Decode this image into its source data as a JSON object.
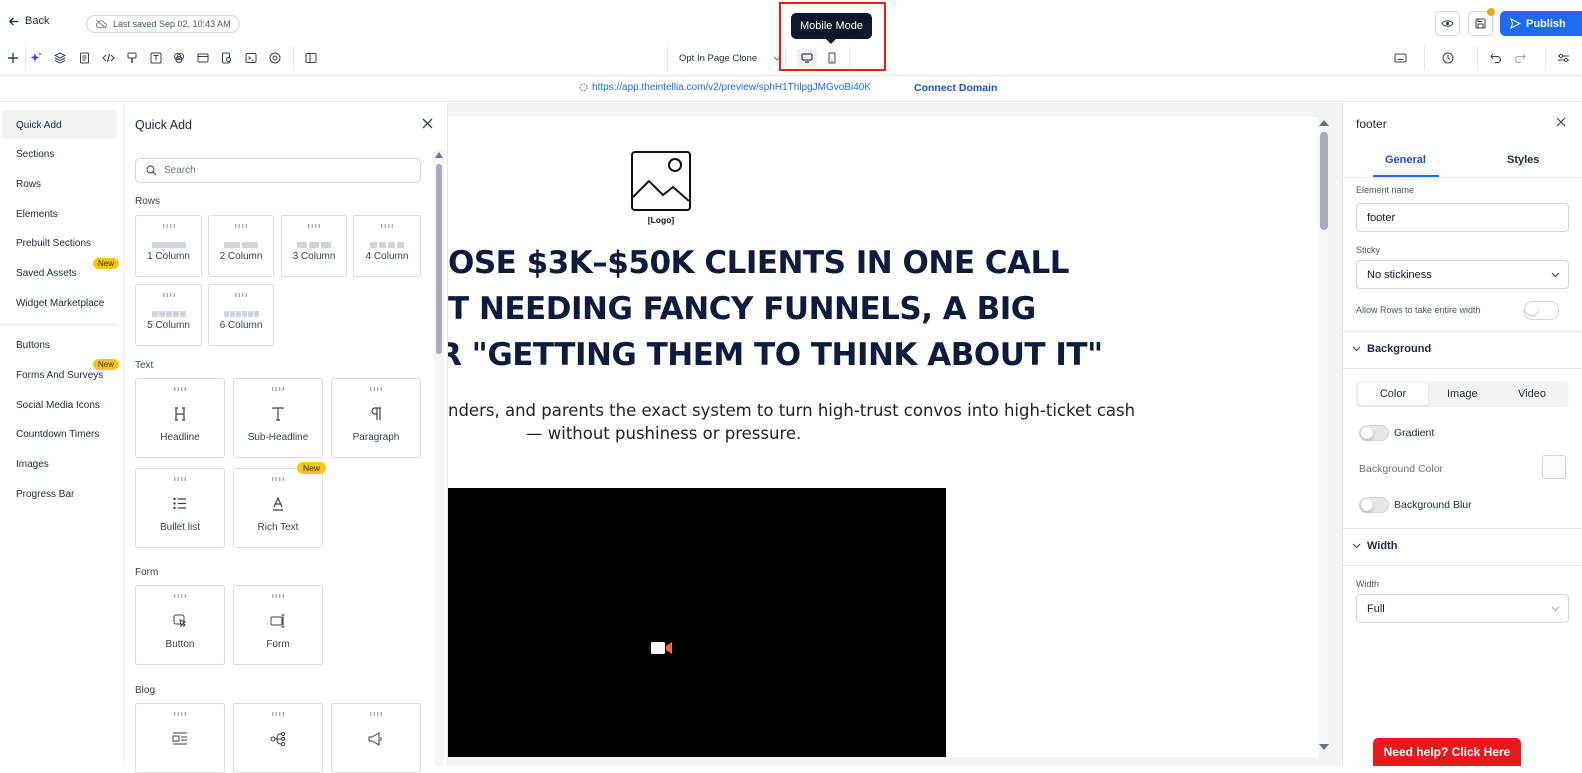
{
  "topbar": {
    "back_label": "Back",
    "last_saved": "Last saved Sep 02, 10:43 AM",
    "page_name": "Opt In Page Clone",
    "tooltip": "Mobile Mode",
    "publish_label": "Publish"
  },
  "urlbar": {
    "url": "https://app.theintellia.com/v2/preview/sphH1ThlpgJMGvoBi40K",
    "connect_label": "Connect Domain"
  },
  "leftnav": {
    "items": [
      "Quick Add",
      "Sections",
      "Rows",
      "Elements",
      "Prebuilt Sections",
      "Saved Assets",
      "Widget Marketplace",
      "Buttons",
      "Forms And Surveys",
      "Social Media Icons",
      "Countdown Timers",
      "Images",
      "Progress Bar"
    ],
    "new_badge": "New"
  },
  "quickadd": {
    "title": "Quick Add",
    "search_placeholder": "Search",
    "sections": {
      "rows": "Rows",
      "text": "Text",
      "form": "Form",
      "blog": "Blog"
    },
    "rows": [
      "1 Column",
      "2 Column",
      "3 Column",
      "4 Column",
      "5 Column",
      "6 Column"
    ],
    "text": [
      "Headline",
      "Sub-Headline",
      "Paragraph",
      "Bullet list",
      "Rich Text"
    ],
    "form": [
      "Button",
      "Form"
    ],
    "new_badge": "New"
  },
  "canvas": {
    "logo_label": "[Logo]",
    "headline_lines": [
      "OSE $3K–$50K CLIENTS IN ONE CALL",
      "T NEEDING FANCY FUNNELS, A BIG",
      "R \"GETTING THEM TO THINK ABOUT IT\""
    ],
    "subhead_lines": [
      "nders, and parents the exact system to turn high-trust convos into high-ticket cash",
      "— without pushiness or pressure."
    ]
  },
  "rightpanel": {
    "title": "footer",
    "tabs": [
      "General",
      "Styles"
    ],
    "element_name_label": "Element name",
    "element_name_value": "footer",
    "sticky_label": "Sticky",
    "sticky_value": "No stickiness",
    "allow_rows_label": "Allow Rows to take entire width",
    "background_section": "Background",
    "bg_tabs": [
      "Color",
      "Image",
      "Video"
    ],
    "gradient_label": "Gradient",
    "bg_color_label": "Background Color",
    "bg_blur_label": "Background Blur",
    "width_section": "Width",
    "width_label": "Width",
    "width_value": "Full"
  },
  "help_button": "Need help? Click Here",
  "colors": {
    "accent": "#1d6bf3",
    "headline": "#0f1b3d",
    "highlight_box": "#e0201b",
    "help": "#e8191c",
    "badge": "#f5c518"
  }
}
